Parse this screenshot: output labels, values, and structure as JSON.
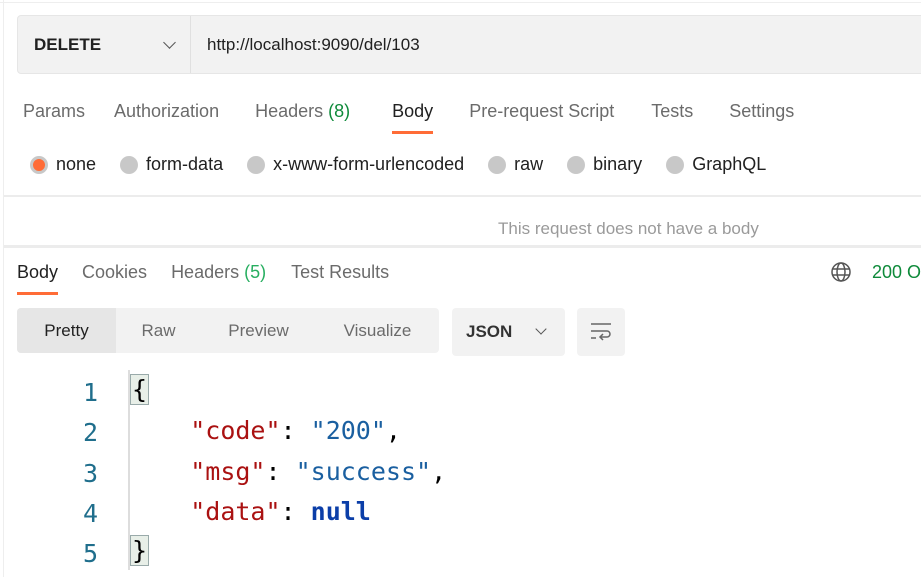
{
  "request": {
    "method": "DELETE",
    "url": "http://localhost:9090/del/103"
  },
  "request_tabs": [
    {
      "label": "Params"
    },
    {
      "label": "Authorization"
    },
    {
      "label": "Headers",
      "count": "(8)"
    },
    {
      "label": "Body",
      "active": true
    },
    {
      "label": "Pre-request Script"
    },
    {
      "label": "Tests"
    },
    {
      "label": "Settings"
    }
  ],
  "body_types": [
    {
      "label": "none",
      "selected": true
    },
    {
      "label": "form-data"
    },
    {
      "label": "x-www-form-urlencoded"
    },
    {
      "label": "raw"
    },
    {
      "label": "binary"
    },
    {
      "label": "GraphQL"
    }
  ],
  "no_body_message": "This request does not have a body",
  "response_tabs": [
    {
      "label": "Body",
      "active": true
    },
    {
      "label": "Cookies"
    },
    {
      "label": "Headers",
      "count": "(5)"
    },
    {
      "label": "Test Results"
    }
  ],
  "status": "200 O",
  "view_modes": [
    "Pretty",
    "Raw",
    "Preview",
    "Visualize"
  ],
  "format": "JSON",
  "code_lines": [
    {
      "num": "1",
      "open": "{"
    },
    {
      "num": "2",
      "key": "\"code\"",
      "value": "\"200\"",
      "comma": ","
    },
    {
      "num": "3",
      "key": "\"msg\"",
      "value": "\"success\"",
      "comma": ","
    },
    {
      "num": "4",
      "key": "\"data\"",
      "value": "null",
      "comma": ""
    },
    {
      "num": "5",
      "open": "}"
    }
  ],
  "colors": {
    "accent": "#ff6c37",
    "status": "#0e8a3a"
  }
}
